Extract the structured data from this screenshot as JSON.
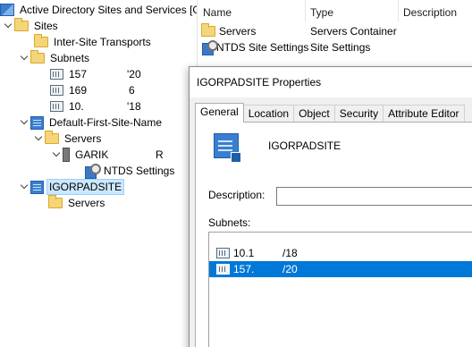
{
  "tree": {
    "root": "Active Directory Sites and Services [G",
    "sites": "Sites",
    "inter_site": "Inter-Site Transports",
    "subnets": "Subnets",
    "subnet_items": [
      {
        "left": "157",
        "right": "'20"
      },
      {
        "left": "169",
        "right": "6"
      },
      {
        "left": "10.",
        "right": "'18"
      }
    ],
    "default_site": "Default-First-Site-Name",
    "servers": "Servers",
    "server_name": "GARIK",
    "server_suffix": "R",
    "ntds": "NTDS Settings",
    "igorpadsite": "IGORPADSITE",
    "igor_servers": "Servers"
  },
  "list": {
    "columns": [
      "Name",
      "Type",
      "Description"
    ],
    "rows": [
      {
        "name": "Servers",
        "type": "Servers Container"
      },
      {
        "name": "NTDS Site Settings",
        "type": "Site Settings"
      }
    ]
  },
  "dialog": {
    "title": "IGORPADSITE Properties",
    "tabs": [
      "General",
      "Location",
      "Object",
      "Security",
      "Attribute Editor"
    ],
    "active_tab": "General",
    "site_name": "IGORPADSITE",
    "description_label": "Description:",
    "description_value": "",
    "subnets_label": "Subnets:",
    "subnets": [
      {
        "left": "10.1",
        "right": "/18"
      },
      {
        "left": "157.",
        "right": "/20"
      }
    ],
    "selected_subnet_index": 1
  }
}
